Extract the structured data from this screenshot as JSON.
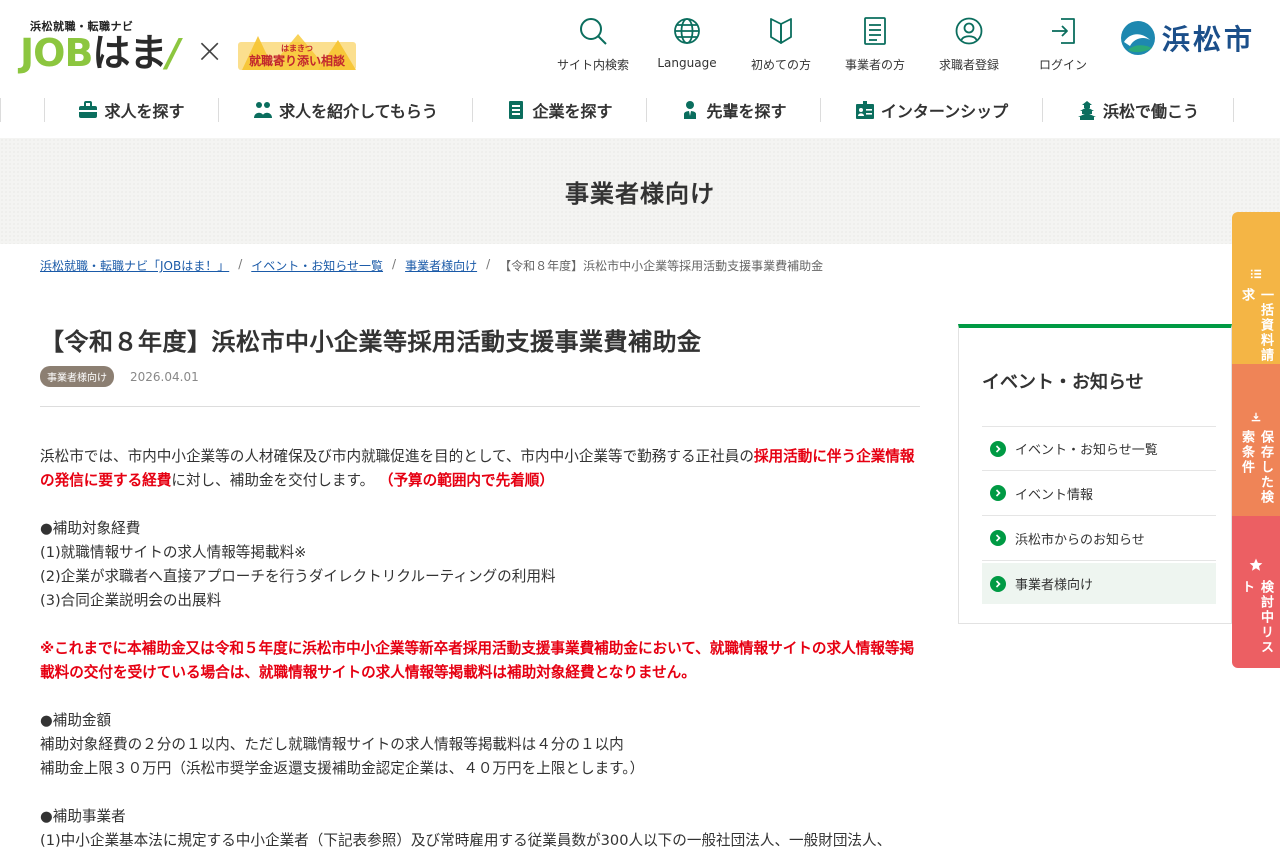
{
  "header": {
    "logo_sub": "浜松就職・転職ナビ",
    "logo_job": "JOB",
    "logo_hama": "はま",
    "logo_excl": "/",
    "partner_logo_text": "はまきつ 就職寄り添い相談",
    "city_name": "浜松市",
    "util_nav": [
      {
        "label": "サイト内検索",
        "icon": "search-icon"
      },
      {
        "label": "Language",
        "icon": "globe-icon"
      },
      {
        "label": "初めての方",
        "icon": "beginner-mark-icon"
      },
      {
        "label": "事業者の方",
        "icon": "document-icon"
      },
      {
        "label": "求職者登録",
        "icon": "person-circle-icon"
      },
      {
        "label": "ログイン",
        "icon": "login-icon"
      }
    ]
  },
  "gnav": [
    {
      "label": "求人を探す",
      "icon": "briefcase-icon"
    },
    {
      "label": "求人を紹介してもらう",
      "icon": "people-icon"
    },
    {
      "label": "企業を探す",
      "icon": "building-icon"
    },
    {
      "label": "先輩を探す",
      "icon": "person-icon"
    },
    {
      "label": "インターンシップ",
      "icon": "id-card-icon"
    },
    {
      "label": "浜松で働こう",
      "icon": "castle-icon"
    }
  ],
  "page": {
    "band_title": "事業者様向け"
  },
  "breadcrumb": {
    "items": [
      "浜松就職・転職ナビ「JOBはま！」",
      "イベント・お知らせ一覧",
      "事業者様向け"
    ],
    "current": "【令和８年度】浜松市中小企業等採用活動支援事業費補助金",
    "separator": "/"
  },
  "article": {
    "title": "【令和８年度】浜松市中小企業等採用活動支援事業費補助金",
    "tag": "事業者様向け",
    "date": "2026.04.01",
    "intro_1": "浜松市では、市内中小企業等の人材確保及び市内就職促進を目的として、市内中小企業等で勤務する正社員の",
    "intro_red": "採用活動に伴う企業情報の発信に要する経費",
    "intro_2": "に対し、補助金を交付します。",
    "intro_note": "（予算の範囲内で先着順）",
    "expense_heading": "●補助対象経費",
    "expense_items": [
      "(1)就職情報サイトの求人情報等掲載料※",
      "(2)企業が求職者へ直接アプローチを行うダイレクトリクルーティングの利用料",
      "(3)合同企業説明会の出展料"
    ],
    "warning": "※これまでに本補助金又は令和５年度に浜松市中小企業等新卒者採用活動支援事業費補助金において、就職情報サイトの求人情報等掲載料の交付を受けている場合は、就職情報サイトの求人情報等掲載料は補助対象経費となりません。",
    "amount_heading": "●補助金額",
    "amount_line_1": "補助対象経費の２分の１以内、ただし就職情報サイトの求人情報等掲載料は４分の１以内",
    "amount_line_2": "補助金上限３０万円（浜松市奨学金返還支援補助金認定企業は、４０万円を上限とします。）",
    "recipient_heading": "●補助事業者",
    "recipient_line_1": "(1)中小企業基本法に規定する中小企業者（下記表参照）及び常時雇用する従業員数が300人以下の一般社団法人、一般財団法人、"
  },
  "sidebar": {
    "title": "イベント・お知らせ",
    "items": [
      "イベント・お知らせ一覧",
      "イベント情報",
      "浜松市からのお知らせ",
      "事業者様向け"
    ],
    "active_index": 3
  },
  "floating": [
    {
      "label": "一括資料請求",
      "icon": "list-icon",
      "color": "#f4b545"
    },
    {
      "label": "保存した検索条件",
      "icon": "download-icon",
      "color": "#ef8457"
    },
    {
      "label": "検討中リスト",
      "icon": "star-icon",
      "color": "#ec5f63"
    }
  ],
  "colors": {
    "brand_green": "#8cc63f",
    "sidebar_accent": "#009a44",
    "warning_red": "#e60012",
    "link_blue": "#1a5aa8",
    "icon_teal": "#0b6e5e",
    "city_blue": "#1b4f8a"
  }
}
